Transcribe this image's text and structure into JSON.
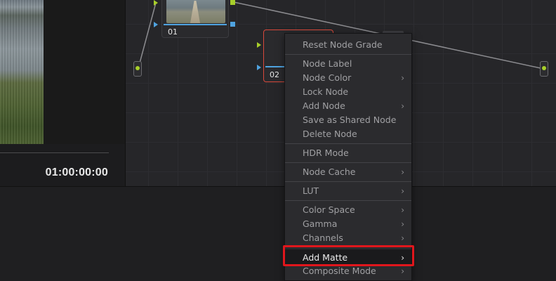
{
  "viewer": {
    "timecode": "01:00:00:00"
  },
  "nodes": [
    {
      "label": "01"
    },
    {
      "label": "02"
    }
  ],
  "context_menu": {
    "items": [
      {
        "label": "Reset Node Grade",
        "submenu": false
      },
      {
        "label": "Node Label",
        "submenu": false
      },
      {
        "label": "Node Color",
        "submenu": true
      },
      {
        "label": "Lock Node",
        "submenu": false
      },
      {
        "label": "Add Node",
        "submenu": true
      },
      {
        "label": "Save as Shared Node",
        "submenu": false
      },
      {
        "label": "Delete Node",
        "submenu": false
      },
      {
        "label": "HDR Mode",
        "submenu": false
      },
      {
        "label": "Node Cache",
        "submenu": true
      },
      {
        "label": "LUT",
        "submenu": true
      },
      {
        "label": "Color Space",
        "submenu": true
      },
      {
        "label": "Gamma",
        "submenu": true
      },
      {
        "label": "Channels",
        "submenu": true
      },
      {
        "label": "Add Matte",
        "submenu": true,
        "highlighted": true
      },
      {
        "label": "Composite Mode",
        "submenu": true
      }
    ],
    "arrow_glyph": "›"
  },
  "colors": {
    "accent_red": "#e0161c",
    "port_green": "#a8cf2a",
    "port_blue": "#4fa3e0"
  }
}
